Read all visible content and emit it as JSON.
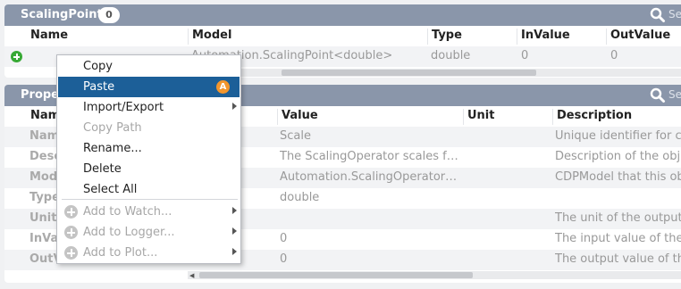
{
  "panel1": {
    "title": "ScalingPoint",
    "count": "0",
    "search_text": "Se",
    "columns": [
      "Name",
      "Model",
      "Type",
      "InValue",
      "OutValue"
    ],
    "row": {
      "model": "Automation.ScalingPoint<double>",
      "type": "double",
      "invalue": "0",
      "outvalue": "0"
    }
  },
  "panel2": {
    "title": "Proper",
    "search_text": "Se",
    "columns": [
      "Nam",
      "Value",
      "Unit",
      "Description"
    ],
    "rows": [
      {
        "name": "Nam",
        "value": "Scale",
        "desc": "Unique identifier for c"
      },
      {
        "name": "Desc",
        "value": "The ScalingOperator scales f…",
        "desc": "Description of the obj"
      },
      {
        "name": "Mod",
        "value": "Automation.ScalingOperator…",
        "desc": "CDPModel that this ob"
      },
      {
        "name": "Type",
        "value": "double",
        "desc": ""
      },
      {
        "name": "Unit",
        "value": "",
        "desc": "The unit of the output"
      },
      {
        "name": "InVa",
        "value": "0",
        "desc": "The input value of the"
      },
      {
        "name": "OutValue",
        "value": "0",
        "desc": "The output value of th",
        "model_fragment": "double"
      }
    ]
  },
  "context_menu": {
    "items": [
      {
        "label": "Copy"
      },
      {
        "label": "Paste",
        "shortcut": "A"
      },
      {
        "label": "Import/Export"
      },
      {
        "label": "Copy Path"
      },
      {
        "label": "Rename..."
      },
      {
        "label": "Delete"
      },
      {
        "label": "Select All"
      },
      {
        "label": "Add to Watch..."
      },
      {
        "label": "Add to Logger..."
      },
      {
        "label": "Add to Plot..."
      }
    ]
  },
  "colors": {
    "header_bg": "#8a96aa",
    "menu_highlight": "#1c5f98",
    "shortcut_badge": "#f3962d",
    "add_icon": "#37a935"
  },
  "icons": [
    "search-icon",
    "plus-circle-icon",
    "chevron-right-icon"
  ]
}
